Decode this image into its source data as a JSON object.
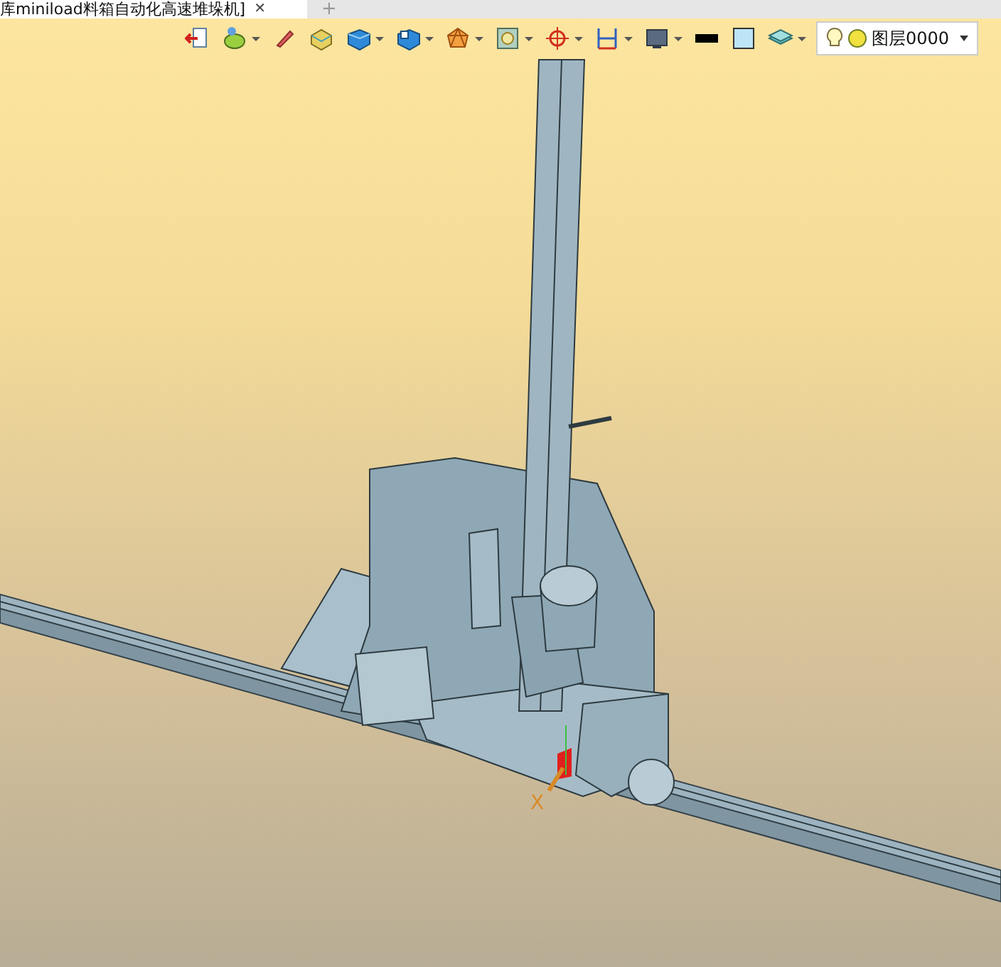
{
  "tab": {
    "title": "库miniload料箱自动化高速堆垛机]",
    "close": "✕",
    "new_tab": "+"
  },
  "toolbar": {
    "tools": [
      {
        "kind": "exit",
        "dropdown": false
      },
      {
        "kind": "palette",
        "dropdown": true
      },
      {
        "kind": "pen",
        "dropdown": false
      },
      {
        "kind": "box",
        "dropdown": false
      },
      {
        "kind": "cube",
        "dropdown": true
      },
      {
        "kind": "view",
        "dropdown": true
      },
      {
        "kind": "wire",
        "dropdown": true
      },
      {
        "kind": "frame",
        "dropdown": true
      },
      {
        "kind": "target",
        "dropdown": true
      },
      {
        "kind": "measure",
        "dropdown": true
      },
      {
        "kind": "monitor",
        "dropdown": true
      },
      {
        "kind": "line",
        "dropdown": false
      },
      {
        "kind": "swatch",
        "dropdown": false
      },
      {
        "kind": "layers",
        "dropdown": true
      }
    ],
    "layer_select": {
      "value": "图层0000"
    }
  },
  "viewport": {
    "axis_label": "X"
  }
}
